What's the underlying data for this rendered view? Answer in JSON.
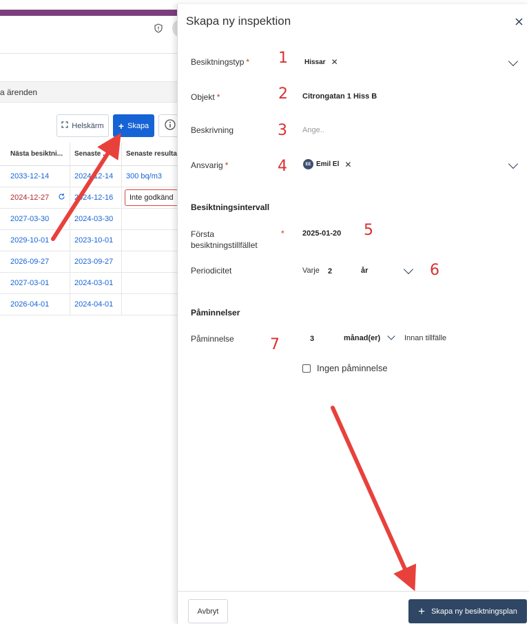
{
  "background": {
    "search_text": "a ärenden",
    "toolbar": {
      "helskarm_label": "Helskärm",
      "skapa_label": "Skapa",
      "info_icon": "info-icon"
    },
    "table": {
      "columns": [
        "Nästa besiktni...",
        "Senaste ...",
        "Senaste resulta..."
      ],
      "rows": [
        {
          "next": "2033-12-14",
          "last": "2024-12-14",
          "result": "300 bq/m3",
          "overdue": false
        },
        {
          "next": "2024-12-27",
          "last": "2024-12-16",
          "result": "Inte godkänd",
          "overdue": true
        },
        {
          "next": "2027-03-30",
          "last": "2024-03-30",
          "result": "",
          "overdue": false
        },
        {
          "next": "2029-10-01",
          "last": "2023-10-01",
          "result": "",
          "overdue": false
        },
        {
          "next": "2026-09-27",
          "last": "2023-09-27",
          "result": "",
          "overdue": false
        },
        {
          "next": "2027-03-01",
          "last": "2024-03-01",
          "result": "",
          "overdue": false
        },
        {
          "next": "2026-04-01",
          "last": "2024-04-01",
          "result": "",
          "overdue": false
        }
      ]
    }
  },
  "panel": {
    "title": "Skapa ny inspektion",
    "fields": {
      "besiktningstyp": {
        "label": "Besiktningstyp",
        "value": "Hissar"
      },
      "objekt": {
        "label": "Objekt",
        "value": "Citrongatan 1 Hiss B"
      },
      "beskrivning": {
        "label": "Beskrivning",
        "placeholder": "Ange.."
      },
      "ansvarig": {
        "label": "Ansvarig",
        "initials": "EE",
        "value": "Emil El"
      }
    },
    "interval": {
      "heading": "Besiktningsintervall",
      "first_label": "Första besiktningstillfället",
      "first_value": "2025-01-20",
      "periodicity_label": "Periodicitet",
      "every_label": "Varje",
      "every_value": "2",
      "unit_value": "år"
    },
    "reminders": {
      "heading": "Påminnelser",
      "label": "Påminnelse",
      "count": "3",
      "unit": "månad(er)",
      "suffix": "Innan tillfälle",
      "no_reminder_label": "Ingen påminnelse"
    },
    "footer": {
      "cancel_label": "Avbryt",
      "create_label": "Skapa ny besiktningsplan"
    }
  },
  "annotations": [
    "1",
    "2",
    "3",
    "4",
    "5",
    "6",
    "7"
  ],
  "colors": {
    "accent": "#1663d6",
    "primary_dark": "#2f4664",
    "annotation_red": "#e8413c",
    "header_purple": "#7b3f7e"
  }
}
